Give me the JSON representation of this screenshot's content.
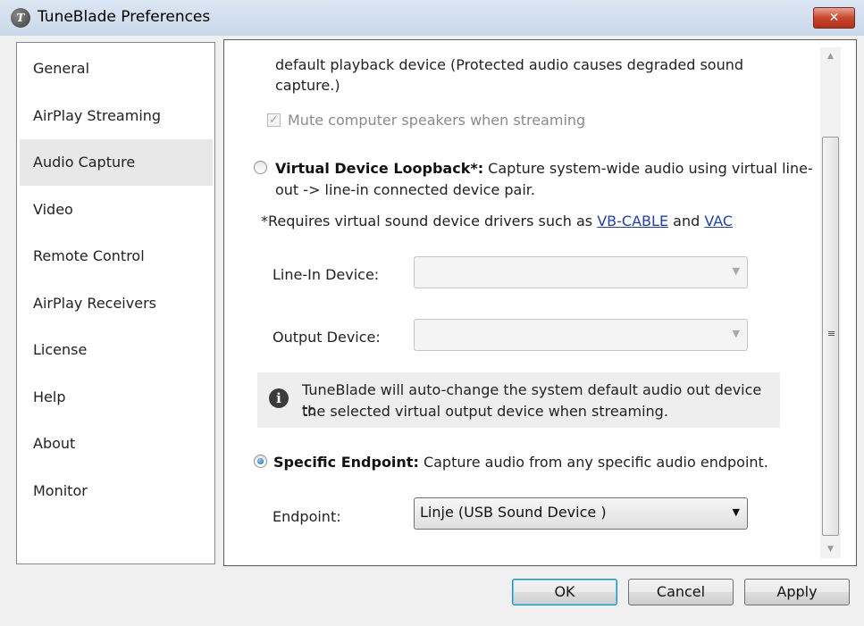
{
  "window": {
    "title": "TuneBlade Preferences",
    "close_symbol": "✕"
  },
  "sidebar": {
    "items": [
      {
        "label": "General"
      },
      {
        "label": "AirPlay Streaming"
      },
      {
        "label": "Audio Capture"
      },
      {
        "label": "Video"
      },
      {
        "label": "Remote Control"
      },
      {
        "label": "AirPlay Receivers"
      },
      {
        "label": "License"
      },
      {
        "label": "Help"
      },
      {
        "label": "About"
      },
      {
        "label": "Monitor"
      }
    ],
    "selected": "Audio Capture"
  },
  "panel": {
    "top_text_line1": "default playback device (Protected audio causes degraded sound",
    "top_text_line2": "capture.)",
    "mute_checkbox": {
      "label": "Mute computer speakers when streaming",
      "checked": true
    },
    "virtual_loopback": {
      "title": "Virtual Device Loopback*:",
      "desc_line1": " Capture system-wide audio using virtual line-",
      "desc_line2": "out -> line-in connected device pair.",
      "selected": false
    },
    "requires_note": {
      "prefix": "*Requires virtual sound device drivers such as ",
      "link1": "VB-CABLE",
      "middle": " and ",
      "link2": "VAC"
    },
    "line_in_label": "Line-In Device:",
    "line_in_value": "",
    "output_label": "Output Device:",
    "output_value": "",
    "info_text_line1": "TuneBlade will auto-change the system default audio out device to",
    "info_text_line2": "the selected virtual output device when streaming.",
    "specific_endpoint": {
      "title": "Specific Endpoint:",
      "desc": " Capture audio from any specific audio endpoint.",
      "selected": true
    },
    "endpoint_label": "Endpoint:",
    "endpoint_value": "Linje (USB Sound Device        )"
  },
  "buttons": {
    "ok": "OK",
    "cancel": "Cancel",
    "apply": "Apply"
  }
}
